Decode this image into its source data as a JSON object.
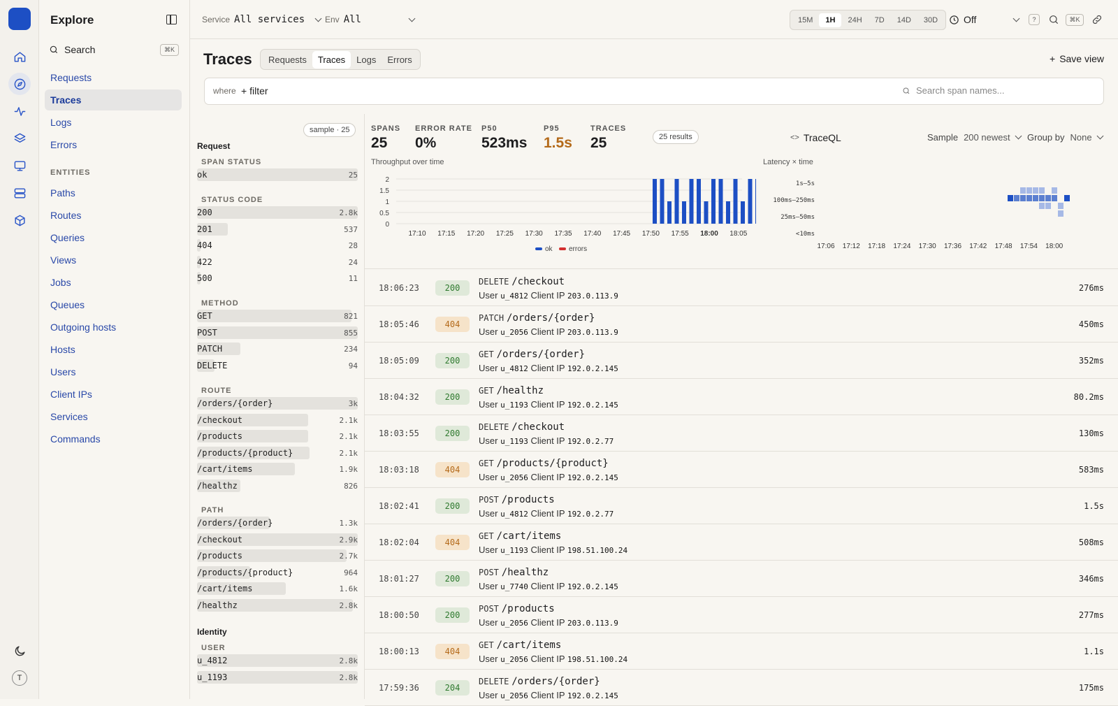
{
  "nav": {
    "title": "Explore",
    "search_label": "Search",
    "search_kbd": "⌘K",
    "items": [
      "Requests",
      "Traces",
      "Logs",
      "Errors"
    ],
    "entities_heading": "ENTITIES",
    "entities": [
      "Paths",
      "Routes",
      "Queries",
      "Views",
      "Jobs",
      "Queues",
      "Outgoing hosts",
      "Hosts",
      "Users",
      "Client IPs",
      "Services",
      "Commands"
    ],
    "avatar": "T"
  },
  "topbar": {
    "service_label": "Service",
    "service_value": "All services",
    "env_label": "Env",
    "env_value": "All",
    "ranges": [
      "15M",
      "1H",
      "24H",
      "7D",
      "14D",
      "30D"
    ],
    "active_range": "1H",
    "refresh_value": "Off",
    "help": "?",
    "kbd": "⌘K"
  },
  "page": {
    "title": "Traces",
    "tabs": [
      "Requests",
      "Traces",
      "Logs",
      "Errors"
    ],
    "active_tab": "Traces",
    "save_view": "Save view",
    "where_label": "where",
    "add_filter": "filter",
    "search_placeholder": "Search span names..."
  },
  "facets": {
    "sample_pill": "sample · 25",
    "request_heading": "Request",
    "identity_heading": "Identity",
    "span_status": {
      "title": "SPAN STATUS",
      "rows": [
        {
          "k": "ok",
          "c": "25",
          "f": 1.0
        }
      ]
    },
    "status_code": {
      "title": "STATUS CODE",
      "rows": [
        {
          "k": "200",
          "c": "2.8k",
          "f": 1.0
        },
        {
          "k": "201",
          "c": "537",
          "f": 0.19
        },
        {
          "k": "404",
          "c": "28",
          "f": 0.01
        },
        {
          "k": "422",
          "c": "24",
          "f": 0.01
        },
        {
          "k": "500",
          "c": "11",
          "f": 0.01
        }
      ]
    },
    "method": {
      "title": "METHOD",
      "rows": [
        {
          "k": "GET",
          "c": "821",
          "f": 0.96
        },
        {
          "k": "POST",
          "c": "855",
          "f": 1.0
        },
        {
          "k": "PATCH",
          "c": "234",
          "f": 0.27
        },
        {
          "k": "DELETE",
          "c": "94",
          "f": 0.11
        }
      ]
    },
    "route": {
      "title": "ROUTE",
      "rows": [
        {
          "k": "/orders/{order}",
          "c": "3k",
          "f": 1.0
        },
        {
          "k": "/checkout",
          "c": "2.1k",
          "f": 0.69
        },
        {
          "k": "/products",
          "c": "2.1k",
          "f": 0.69
        },
        {
          "k": "/products/{product}",
          "c": "2.1k",
          "f": 0.7
        },
        {
          "k": "/cart/items",
          "c": "1.9k",
          "f": 0.61
        },
        {
          "k": "/healthz",
          "c": "826",
          "f": 0.27
        }
      ]
    },
    "path": {
      "title": "PATH",
      "rows": [
        {
          "k": "/orders/{order}",
          "c": "1.3k",
          "f": 0.45
        },
        {
          "k": "/checkout",
          "c": "2.9k",
          "f": 1.0
        },
        {
          "k": "/products",
          "c": "2.7k",
          "f": 0.93
        },
        {
          "k": "/products/{product}",
          "c": "964",
          "f": 0.33
        },
        {
          "k": "/cart/items",
          "c": "1.6k",
          "f": 0.55
        },
        {
          "k": "/healthz",
          "c": "2.8k",
          "f": 0.97
        }
      ]
    },
    "user": {
      "title": "USER",
      "rows": [
        {
          "k": "u_4812",
          "c": "2.8k",
          "f": 1.0
        },
        {
          "k": "u_1193",
          "c": "2.8k",
          "f": 1.0
        }
      ]
    }
  },
  "stats": [
    {
      "label": "SPANS",
      "value": "25"
    },
    {
      "label": "ERROR RATE",
      "value": "0%"
    },
    {
      "label": "P50",
      "value": "523ms"
    },
    {
      "label": "P95",
      "value": "1.5s"
    },
    {
      "label": "TRACES",
      "value": "25"
    }
  ],
  "results_pill": "25 results",
  "traceql": "TraceQL",
  "sample": {
    "label": "Sample",
    "value": "200 newest"
  },
  "groupby": {
    "label": "Group by",
    "value": "None"
  },
  "colors": {
    "ok": "#1d4fc4",
    "errors": "#d32f2f",
    "p95": "#b46a1a"
  },
  "chart_data": [
    {
      "type": "bar",
      "title": "Throughput over time",
      "x_ticks": [
        "17:10",
        "17:15",
        "17:20",
        "17:25",
        "17:30",
        "17:35",
        "17:40",
        "17:45",
        "17:50",
        "17:55",
        "18:00",
        "18:05"
      ],
      "y_ticks": [
        "0",
        "0.5",
        "1",
        "1.5",
        "2"
      ],
      "ylim": [
        0,
        2
      ],
      "legend": [
        "ok",
        "errors"
      ],
      "series": [
        {
          "name": "ok",
          "values": [
            2,
            2,
            1,
            2,
            1,
            2,
            2,
            1,
            2,
            2,
            1,
            2,
            1,
            2,
            2
          ]
        },
        {
          "name": "errors",
          "values": [
            0,
            0,
            0,
            0,
            0,
            0,
            0,
            0,
            0,
            0,
            0,
            0,
            0,
            0,
            0
          ]
        }
      ]
    },
    {
      "type": "heatmap",
      "title": "Latency × time",
      "y_ticks": [
        "1s–5s",
        "100ms–250ms",
        "25ms–50ms",
        "<10ms"
      ],
      "x_ticks": [
        "17:06",
        "17:12",
        "17:18",
        "17:24",
        "17:30",
        "17:36",
        "17:42",
        "17:48",
        "17:54",
        "18:00"
      ],
      "cells": [
        [
          0,
          2
        ],
        [
          1,
          2
        ],
        [
          2,
          1
        ],
        [
          2,
          2
        ],
        [
          3,
          1
        ],
        [
          3,
          2
        ],
        [
          4,
          1
        ],
        [
          4,
          2
        ],
        [
          5,
          1
        ],
        [
          5,
          2
        ],
        [
          5,
          3
        ],
        [
          6,
          2
        ],
        [
          6,
          3
        ],
        [
          7,
          1
        ],
        [
          7,
          2
        ],
        [
          8,
          3
        ],
        [
          8,
          4
        ],
        [
          9,
          2
        ]
      ]
    }
  ],
  "traces": [
    {
      "time": "18:06:23",
      "status": "200",
      "method": "DELETE",
      "path": "/checkout",
      "user": "u_4812",
      "ip": "203.0.113.9",
      "dur": "276ms"
    },
    {
      "time": "18:05:46",
      "status": "404",
      "method": "PATCH",
      "path": "/orders/{order}",
      "user": "u_2056",
      "ip": "203.0.113.9",
      "dur": "450ms"
    },
    {
      "time": "18:05:09",
      "status": "200",
      "method": "GET",
      "path": "/orders/{order}",
      "user": "u_4812",
      "ip": "192.0.2.145",
      "dur": "352ms"
    },
    {
      "time": "18:04:32",
      "status": "200",
      "method": "GET",
      "path": "/healthz",
      "user": "u_1193",
      "ip": "192.0.2.145",
      "dur": "80.2ms"
    },
    {
      "time": "18:03:55",
      "status": "200",
      "method": "DELETE",
      "path": "/checkout",
      "user": "u_1193",
      "ip": "192.0.2.77",
      "dur": "130ms"
    },
    {
      "time": "18:03:18",
      "status": "404",
      "method": "GET",
      "path": "/products/{product}",
      "user": "u_2056",
      "ip": "192.0.2.145",
      "dur": "583ms"
    },
    {
      "time": "18:02:41",
      "status": "200",
      "method": "POST",
      "path": "/products",
      "user": "u_4812",
      "ip": "192.0.2.77",
      "dur": "1.5s"
    },
    {
      "time": "18:02:04",
      "status": "404",
      "method": "GET",
      "path": "/cart/items",
      "user": "u_1193",
      "ip": "198.51.100.24",
      "dur": "508ms"
    },
    {
      "time": "18:01:27",
      "status": "200",
      "method": "POST",
      "path": "/healthz",
      "user": "u_7740",
      "ip": "192.0.2.145",
      "dur": "346ms"
    },
    {
      "time": "18:00:50",
      "status": "200",
      "method": "POST",
      "path": "/products",
      "user": "u_2056",
      "ip": "203.0.113.9",
      "dur": "277ms"
    },
    {
      "time": "18:00:13",
      "status": "404",
      "method": "GET",
      "path": "/cart/items",
      "user": "u_2056",
      "ip": "198.51.100.24",
      "dur": "1.1s"
    },
    {
      "time": "17:59:36",
      "status": "204",
      "method": "DELETE",
      "path": "/orders/{order}",
      "user": "u_2056",
      "ip": "192.0.2.145",
      "dur": "175ms"
    }
  ],
  "row_labels": {
    "user": "User",
    "ip": "Client IP"
  }
}
